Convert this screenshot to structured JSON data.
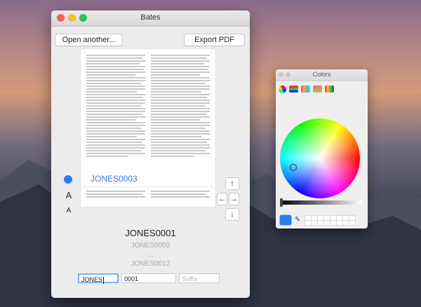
{
  "bates": {
    "window_title": "Bates",
    "open_button": "Open another...",
    "export_button": "Export PDF",
    "stamp_on_page": "JONES0003",
    "preview_numbers": [
      "JONES0001",
      "JONES0002",
      "...",
      "JONES0012"
    ],
    "fields": {
      "prefix_value": "JONES",
      "start_value": "0001",
      "suffix_placeholder": "Suffix"
    },
    "side_controls": {
      "font_large": "A",
      "font_small": "A"
    },
    "arrows": {
      "up": "↑",
      "left": "←",
      "right": "→",
      "down": "↓"
    }
  },
  "colors_panel": {
    "title": "Colors",
    "current_color": "#2a7ef5"
  }
}
